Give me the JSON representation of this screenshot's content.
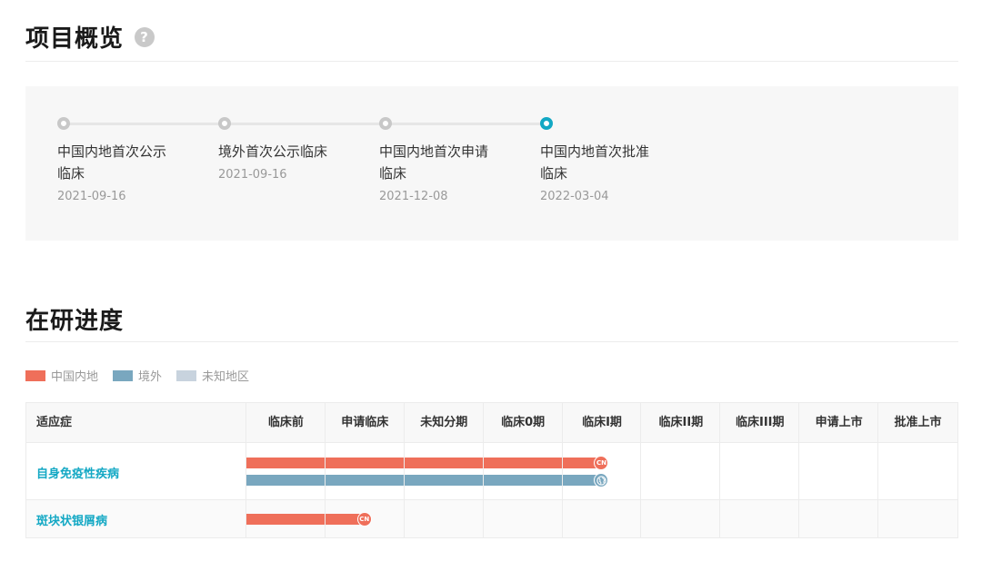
{
  "overview": {
    "title": "项目概览",
    "help_icon": "?",
    "milestones": [
      {
        "name": "中国内地首次公示临床",
        "date": "2021-09-16",
        "active": false
      },
      {
        "name": "境外首次公示临床",
        "date": "2021-09-16",
        "active": false
      },
      {
        "name": "中国内地首次申请临床",
        "date": "2021-12-08",
        "active": false
      },
      {
        "name": "中国内地首次批准临床",
        "date": "2022-03-04",
        "active": true
      }
    ],
    "colors": {
      "active": "#13a8c4",
      "inactive": "#c8c8c8"
    }
  },
  "progress": {
    "title": "在研进度",
    "legend": [
      {
        "label": "中国内地",
        "color": "#ef6f5a"
      },
      {
        "label": "境外",
        "color": "#79a7bf"
      },
      {
        "label": "未知地区",
        "color": "#c8d3de"
      }
    ],
    "columns": [
      "适应症",
      "临床前",
      "申请临床",
      "未知分期",
      "临床0期",
      "临床I期",
      "临床II期",
      "临床III期",
      "申请上市",
      "批准上市"
    ],
    "rows": [
      {
        "indication": "自身免疫性疾病",
        "bars": [
          {
            "region": "中国内地",
            "color": "#ef6f5a",
            "stage_reached": "临床I期",
            "stage_index": 4,
            "badge": "CN",
            "icon": "globe-icon-cn"
          },
          {
            "region": "境外",
            "color": "#79a7bf",
            "stage_reached": "临床I期",
            "stage_index": 4,
            "badge": "",
            "icon": "globe-icon"
          }
        ]
      },
      {
        "indication": "斑块状银屑病",
        "bars": [
          {
            "region": "中国内地",
            "color": "#ef6f5a",
            "stage_reached": "申请临床",
            "stage_index": 1,
            "badge": "CN",
            "icon": "globe-icon-cn"
          }
        ]
      }
    ]
  }
}
